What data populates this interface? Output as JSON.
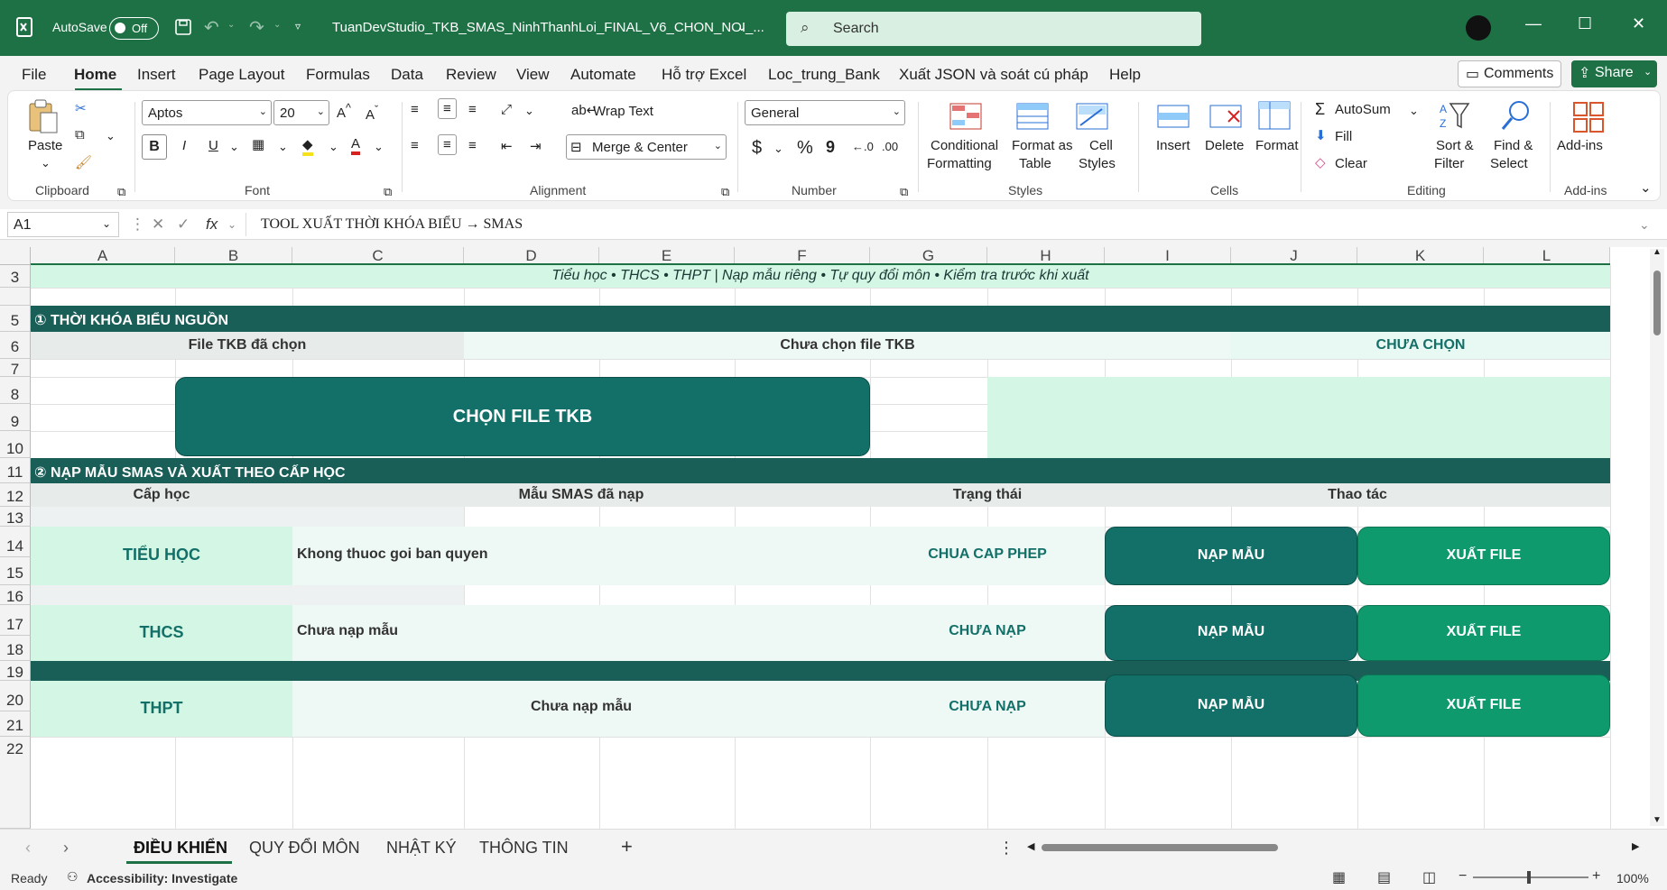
{
  "titlebar": {
    "autosave_label": "AutoSave",
    "autosave_state": "Off",
    "filename": "TuanDevStudio_TKB_SMAS_NinhThanhLoi_FINAL_V6_CHON_NOI_...",
    "search_placeholder": "Search",
    "accent": "#1e7145"
  },
  "menu": {
    "items": [
      "File",
      "Home",
      "Insert",
      "Page Layout",
      "Formulas",
      "Data",
      "Review",
      "View",
      "Automate",
      "Hỗ trợ Excel",
      "Loc_trung_Bank",
      "Xuất JSON và soát cú pháp",
      "Help"
    ],
    "active": "Home",
    "comments": "Comments",
    "share": "Share"
  },
  "ribbon": {
    "clipboard": {
      "paste": "Paste",
      "group": "Clipboard"
    },
    "font": {
      "name": "Aptos",
      "size": "20",
      "group": "Font",
      "bold": "B",
      "italic": "I",
      "underline": "U"
    },
    "alignment": {
      "wrap": "Wrap Text",
      "merge": "Merge & Center",
      "group": "Alignment"
    },
    "number": {
      "format": "General",
      "group": "Number",
      "currency": "$",
      "percent": "%",
      "comma": "9"
    },
    "styles": {
      "conditional_1": "Conditional",
      "conditional_2": "Formatting",
      "table_1": "Format as",
      "table_2": "Table",
      "cell_1": "Cell",
      "cell_2": "Styles",
      "group": "Styles"
    },
    "cells": {
      "insert": "Insert",
      "delete": "Delete",
      "format": "Format",
      "group": "Cells"
    },
    "editing": {
      "autosum": "AutoSum",
      "fill": "Fill",
      "clear": "Clear",
      "sort_1": "Sort &",
      "sort_2": "Filter",
      "find_1": "Find &",
      "find_2": "Select",
      "group": "Editing"
    },
    "addins": {
      "label": "Add-ins",
      "group": "Add-ins"
    }
  },
  "formula_bar": {
    "namebox": "A1",
    "fx": "fx",
    "content": "TOOL XUẤT THỜI KHÓA BIỂU → SMAS"
  },
  "columns": [
    "A",
    "B",
    "C",
    "D",
    "E",
    "F",
    "G",
    "H",
    "I",
    "J",
    "K",
    "L"
  ],
  "rows": [
    "3",
    "5",
    "6",
    "7",
    "8",
    "9",
    "10",
    "11",
    "12",
    "13",
    "14",
    "15",
    "16",
    "17",
    "18",
    "19",
    "20",
    "21",
    "22"
  ],
  "sheet": {
    "subtitle": "Tiểu học • THCS • THPT  |  Nạp mẫu riêng • Tự quy đổi môn • Kiểm tra trước khi xuất",
    "section1": "① THỜI KHÓA BIỂU NGUỒN",
    "file_label": "File TKB đã chọn",
    "file_value": "Chưa chọn file TKB",
    "file_status": "CHƯA CHỌN",
    "choose_button": "CHỌN FILE TKB",
    "section2": "② NẠP MẪU SMAS VÀ XUẤT THEO CẤP HỌC",
    "headers": {
      "level": "Cấp học",
      "template": "Mẫu SMAS đã nạp",
      "status": "Trạng thái",
      "action": "Thao tác"
    },
    "levels": [
      {
        "name": "TIỂU HỌC",
        "template": "Khong thuoc goi ban quyen",
        "status": "CHUA CAP PHEP",
        "load": "NẠP MẪU",
        "export": "XUẤT FILE"
      },
      {
        "name": "THCS",
        "template": "Chưa nạp mẫu",
        "status": "CHƯA NẠP",
        "load": "NẠP MẪU",
        "export": "XUẤT FILE"
      },
      {
        "name": "THPT",
        "template": "Chưa nạp mẫu",
        "status": "CHƯA NẠP",
        "load": "NẠP MẪU",
        "export": "XUẤT FILE"
      }
    ],
    "colors": {
      "dark": "#1a5e58",
      "teal": "#137068",
      "green": "#0f9a6d",
      "mint": "#d3f7e4",
      "pale": "#eef8f5",
      "header_gray": "#e7ebea"
    }
  },
  "tabs": [
    "ĐIỀU KHIỂN",
    "QUY ĐỔI MÔN",
    "NHẬT KÝ",
    "THÔNG TIN"
  ],
  "status": {
    "ready": "Ready",
    "accessibility": "Accessibility: Investigate",
    "zoom": "100%"
  }
}
